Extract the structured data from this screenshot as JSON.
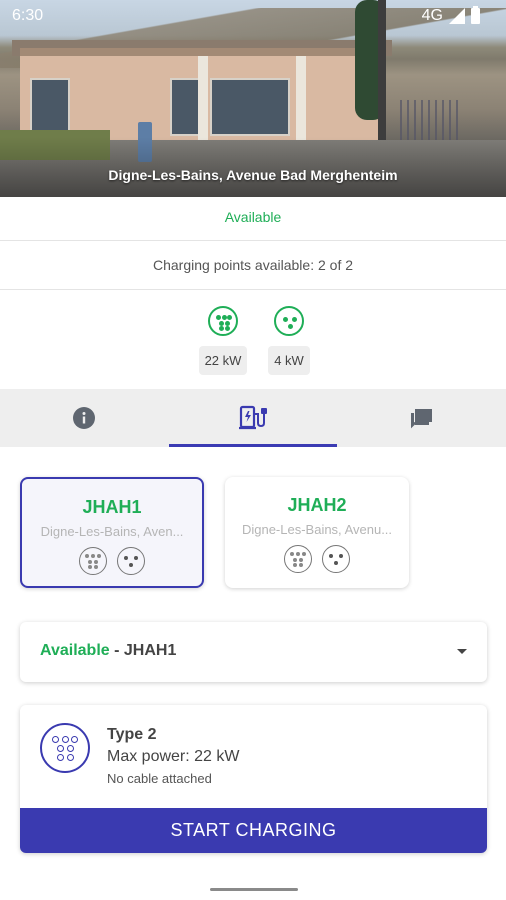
{
  "status_bar": {
    "time": "6:30",
    "network": "4G"
  },
  "station": {
    "title": "Digne-Les-Bains, Avenue Bad Merghenteim",
    "availability": "Available",
    "points_summary": "Charging points available: 2 of 2",
    "connectors": [
      {
        "icon": "type2-connector-icon",
        "power": "22 kW"
      },
      {
        "icon": "domestic-plug-icon",
        "power": "4 kW"
      }
    ]
  },
  "tabs": [
    {
      "icon": "info-icon",
      "active": false
    },
    {
      "icon": "charging-station-icon",
      "active": true
    },
    {
      "icon": "comments-icon",
      "active": false
    }
  ],
  "charging_points": [
    {
      "name": "JHAH1",
      "address": "Digne-Les-Bains, Aven...",
      "selected": true
    },
    {
      "name": "JHAH2",
      "address": "Digne-Les-Bains, Avenu...",
      "selected": false
    }
  ],
  "dropdown": {
    "status": "Available",
    "separator": " - ",
    "point": "JHAH1"
  },
  "connector_detail": {
    "type": "Type 2",
    "max_power": "Max power: 22 kW",
    "cable": "No cable attached"
  },
  "start_button": "START CHARGING",
  "colors": {
    "accent": "#3a3ab0",
    "available": "#1fae57"
  }
}
